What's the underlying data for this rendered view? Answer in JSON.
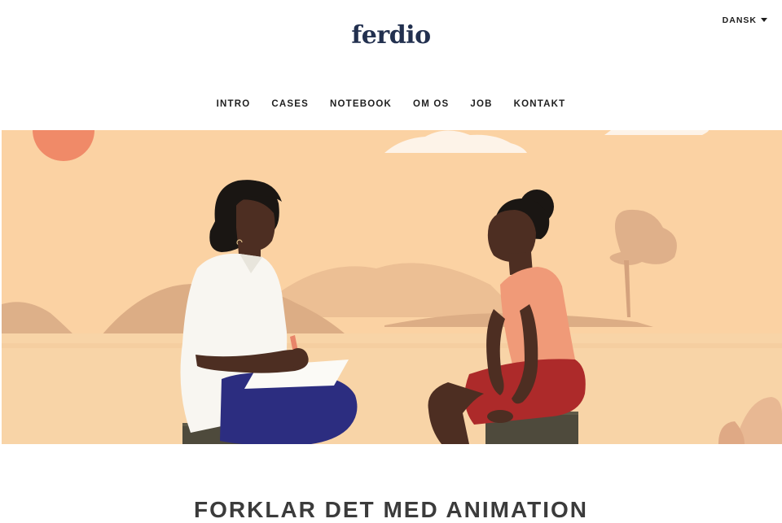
{
  "brand": {
    "logo_text": "ferdio"
  },
  "language": {
    "selected": "DANSK"
  },
  "nav": {
    "items": [
      {
        "label": "INTRO"
      },
      {
        "label": "CASES"
      },
      {
        "label": "NOTEBOOK"
      },
      {
        "label": "OM OS"
      },
      {
        "label": "JOB"
      },
      {
        "label": "KONTAKT"
      }
    ]
  },
  "hero": {
    "illustration": "two-women-conversation-illustration",
    "colors": {
      "sky": "#fad2a3",
      "sun": "#f08a68",
      "hills": "#dcae86",
      "ground": "#f8d5a8"
    }
  },
  "headline": {
    "text": "FORKLAR DET MED ANIMATION"
  }
}
